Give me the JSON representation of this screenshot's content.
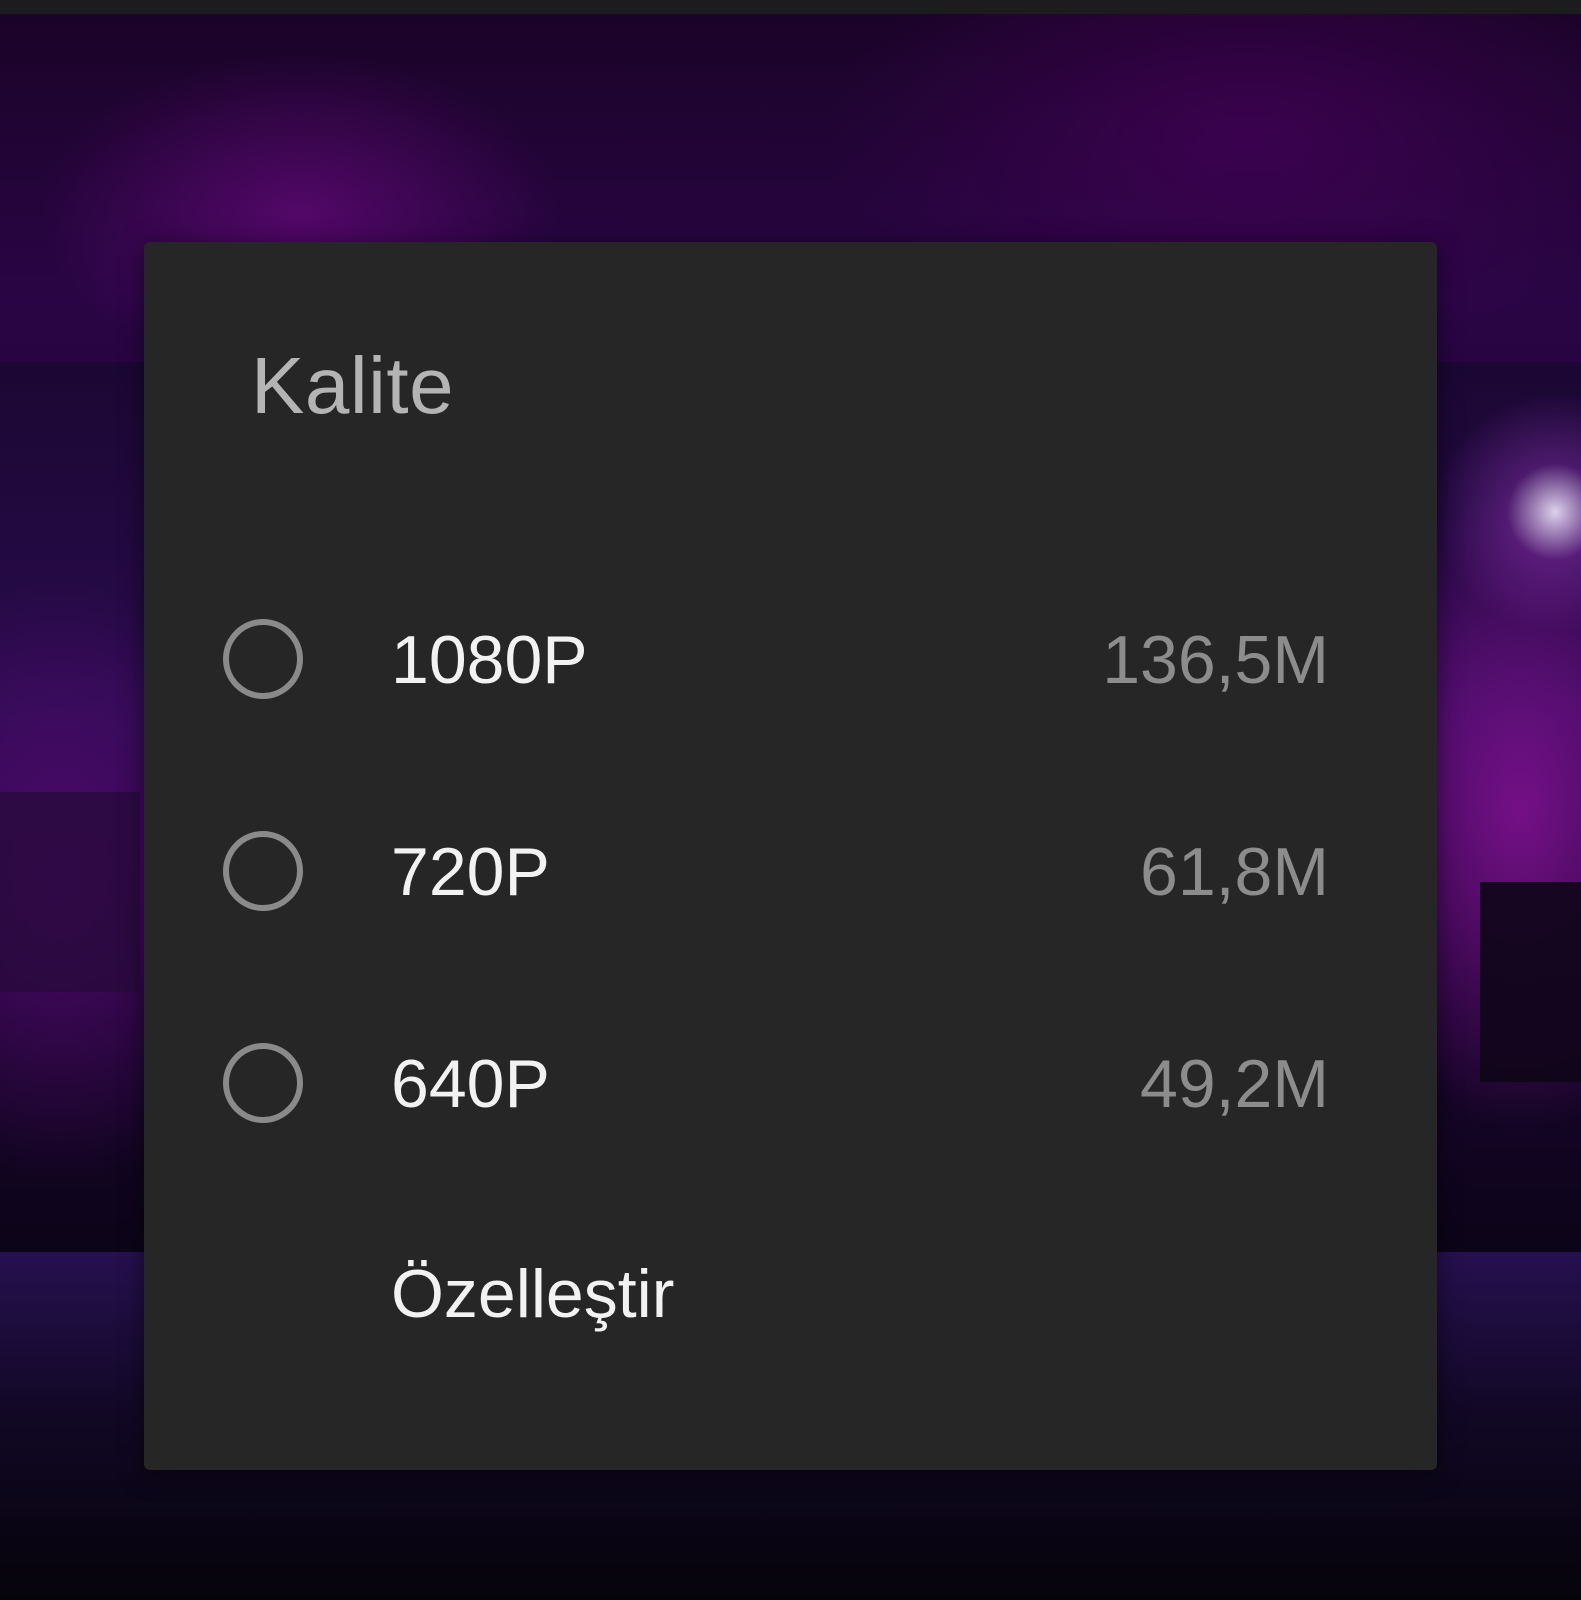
{
  "background": {
    "description_colors": {
      "accent": "#2a0545",
      "highlight": "#b01ab8"
    }
  },
  "dialog": {
    "title": "Kalite",
    "background_color": "#262626",
    "options": [
      {
        "label": "1080P",
        "size": "136,5M",
        "selected": false
      },
      {
        "label": "720P",
        "size": "61,8M",
        "selected": false
      },
      {
        "label": "640P",
        "size": "49,2M",
        "selected": false
      }
    ],
    "customize_label": "Özelleştir",
    "radio_icon": "radio-unchecked-icon"
  }
}
